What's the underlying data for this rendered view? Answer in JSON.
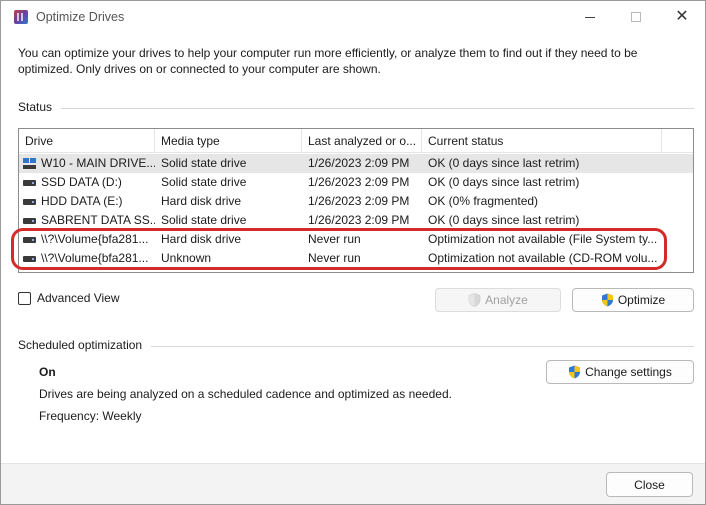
{
  "window": {
    "title": "Optimize Drives"
  },
  "intro": "You can optimize your drives to help your computer run more efficiently, or analyze them to find out if they need to be optimized. Only drives on or connected to your computer are shown.",
  "status": {
    "label": "Status",
    "columns": [
      "Drive",
      "Media type",
      "Last analyzed or o...",
      "Current status"
    ],
    "rows": [
      {
        "drive": "W10 - MAIN DRIVE...",
        "media": "Solid state drive",
        "last": "1/26/2023 2:09 PM",
        "status": "OK (0 days since last retrim)",
        "icon": "system-drive-icon",
        "selected": true
      },
      {
        "drive": "SSD DATA (D:)",
        "media": "Solid state drive",
        "last": "1/26/2023 2:09 PM",
        "status": "OK (0 days since last retrim)",
        "icon": "drive-icon"
      },
      {
        "drive": "HDD DATA (E:)",
        "media": "Hard disk drive",
        "last": "1/26/2023 2:09 PM",
        "status": "OK (0% fragmented)",
        "icon": "drive-icon"
      },
      {
        "drive": "SABRENT DATA SS...",
        "media": "Solid state drive",
        "last": "1/26/2023 2:09 PM",
        "status": "OK (0 days since last retrim)",
        "icon": "drive-icon"
      },
      {
        "drive": "\\\\?\\Volume{bfa281...",
        "media": "Hard disk drive",
        "last": "Never run",
        "status": "Optimization not available (File System ty...",
        "icon": "drive-icon"
      },
      {
        "drive": "\\\\?\\Volume{bfa281...",
        "media": "Unknown",
        "last": "Never run",
        "status": "Optimization not available (CD-ROM volu...",
        "icon": "drive-icon"
      }
    ]
  },
  "advanced_view_label": "Advanced View",
  "buttons": {
    "analyze": "Analyze",
    "optimize": "Optimize",
    "change_settings": "Change settings",
    "close": "Close"
  },
  "scheduled": {
    "label": "Scheduled optimization",
    "state": "On",
    "description": "Drives are being analyzed on a scheduled cadence and optimized as needed.",
    "frequency": "Frequency: Weekly"
  },
  "colors": {
    "annotation": "#d42a2a",
    "selected_row": "#e6e6e6"
  }
}
